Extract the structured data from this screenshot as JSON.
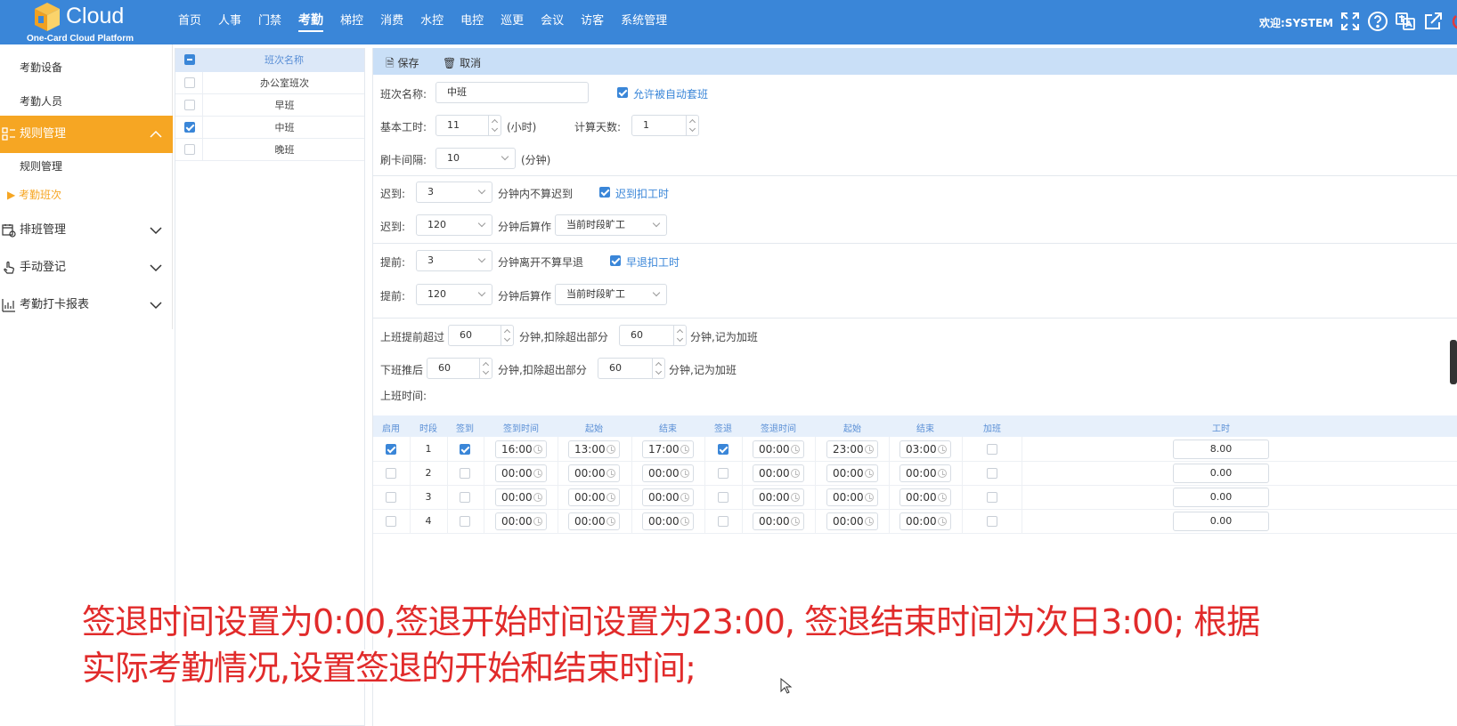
{
  "brand": {
    "name": "Cloud",
    "tagline": "One-Card Cloud Platform"
  },
  "nav": [
    "首页",
    "人事",
    "门禁",
    "考勤",
    "梯控",
    "消费",
    "水控",
    "电控",
    "巡更",
    "会议",
    "访客",
    "系统管理"
  ],
  "nav_active_index": 3,
  "welcome": "欢迎:SYSTEM",
  "top_icons": [
    "fullscreen-icon",
    "help-icon",
    "language-icon",
    "external-link-icon",
    "power-icon"
  ],
  "sidebar": {
    "sub_top": [
      "考勤设备",
      "考勤人员"
    ],
    "group_rules": "规则管理",
    "group_rules_children": [
      "规则管理",
      "考勤班次"
    ],
    "group_rules_current": "考勤班次",
    "groups": [
      "排班管理",
      "手动登记",
      "考勤打卡报表"
    ]
  },
  "shift_list": {
    "header": "班次名称",
    "items": [
      {
        "name": "办公室班次",
        "checked": false
      },
      {
        "name": "早班",
        "checked": false
      },
      {
        "name": "中班",
        "checked": true
      },
      {
        "name": "晚班",
        "checked": false
      }
    ]
  },
  "toolbar": {
    "save": "保存",
    "cancel": "取消"
  },
  "form": {
    "shift_name_label": "班次名称:",
    "shift_name": "中班",
    "auto_schedule_label": "允许被自动套班",
    "base_hours_label": "基本工时:",
    "base_hours": "11",
    "hours_unit": "(小时)",
    "calc_days_label": "计算天数:",
    "calc_days": "1",
    "swipe_interval_label": "刷卡间隔:",
    "swipe_interval": "10",
    "minutes_unit": "(分钟)",
    "late_label": "迟到:",
    "late_minutes": "3",
    "late_not_count": "分钟内不算迟到",
    "late_deduct": "迟到扣工时",
    "late2_minutes": "120",
    "after_count_as": "分钟后算作",
    "absent_option": "当前时段旷工",
    "early_label": "提前:",
    "early_minutes": "3",
    "early_not_count": "分钟离开不算早退",
    "early_deduct": "早退扣工时",
    "early2_minutes": "120",
    "ot_before_label": "上班提前超过",
    "ot_before_minutes": "60",
    "deduct_excess": "分钟,扣除超出部分",
    "ot_before_deduct": "60",
    "count_as_ot": "分钟,记为加班",
    "ot_after_label": "下班推后",
    "ot_after_minutes": "60",
    "ot_after_deduct": "60",
    "work_time_label": "上班时间:"
  },
  "table": {
    "headers": [
      "启用",
      "时段",
      "签到",
      "签到时间",
      "起始",
      "结束",
      "签退",
      "签退时间",
      "起始",
      "结束",
      "加班",
      "工时"
    ],
    "rows": [
      {
        "enabled": true,
        "period": "1",
        "checkin": true,
        "checkin_time": "16:00",
        "ci_start": "13:00",
        "ci_end": "17:00",
        "checkout": true,
        "checkout_time": "00:00",
        "co_start": "23:00",
        "co_end": "03:00",
        "overtime": false,
        "hours": "8.00"
      },
      {
        "enabled": false,
        "period": "2",
        "checkin": false,
        "checkin_time": "00:00",
        "ci_start": "00:00",
        "ci_end": "00:00",
        "checkout": false,
        "checkout_time": "00:00",
        "co_start": "00:00",
        "co_end": "00:00",
        "overtime": false,
        "hours": "0.00"
      },
      {
        "enabled": false,
        "period": "3",
        "checkin": false,
        "checkin_time": "00:00",
        "ci_start": "00:00",
        "ci_end": "00:00",
        "checkout": false,
        "checkout_time": "00:00",
        "co_start": "00:00",
        "co_end": "00:00",
        "overtime": false,
        "hours": "0.00"
      },
      {
        "enabled": false,
        "period": "4",
        "checkin": false,
        "checkin_time": "00:00",
        "ci_start": "00:00",
        "ci_end": "00:00",
        "checkout": false,
        "checkout_time": "00:00",
        "co_start": "00:00",
        "co_end": "00:00",
        "overtime": false,
        "hours": "0.00"
      }
    ]
  },
  "subtitle": {
    "line1": "签退时间设置为0:00,签退开始时间设置为23:00, 签退结束时间为次日3:00; 根据",
    "line2": "实际考勤情况,设置签退的开始和结束时间;"
  },
  "colors": {
    "topbar": "#3a86d8",
    "accent": "#f6a623",
    "subtitle": "#e12b2b"
  }
}
